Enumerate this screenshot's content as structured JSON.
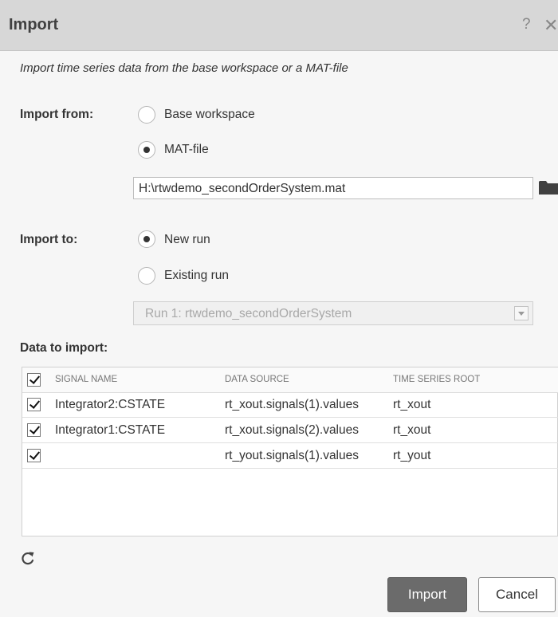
{
  "window": {
    "title": "Import",
    "help_label": "?",
    "close_label": "✕"
  },
  "description": "Import time series data from the base workspace or a MAT-file",
  "import_from": {
    "label": "Import from:",
    "options": [
      {
        "label": "Base workspace",
        "selected": false
      },
      {
        "label": "MAT-file",
        "selected": true
      }
    ],
    "file_path": "H:\\rtwdemo_secondOrderSystem.mat"
  },
  "import_to": {
    "label": "Import to:",
    "options": [
      {
        "label": "New run",
        "selected": true
      },
      {
        "label": "Existing run",
        "selected": false
      }
    ],
    "run_select": "Run 1: rtwdemo_secondOrderSystem"
  },
  "data_to_import": {
    "label": "Data to import:",
    "headers": [
      "SIGNAL NAME",
      "DATA SOURCE",
      "TIME SERIES ROOT"
    ],
    "header_checked": true,
    "rows": [
      {
        "checked": true,
        "signal": "Integrator2:CSTATE",
        "source": "rt_xout.signals(1).values",
        "root": "rt_xout"
      },
      {
        "checked": true,
        "signal": "Integrator1:CSTATE",
        "source": "rt_xout.signals(2).values",
        "root": "rt_xout"
      },
      {
        "checked": true,
        "signal": "",
        "source": "rt_yout.signals(1).values",
        "root": "rt_yout"
      }
    ]
  },
  "buttons": {
    "import": "Import",
    "cancel": "Cancel"
  },
  "icons": {
    "browse": "folder-icon",
    "refresh": "refresh-icon"
  },
  "colors": {
    "titlebar": "#d7d7d7",
    "primary_button": "#6b6b6b"
  }
}
